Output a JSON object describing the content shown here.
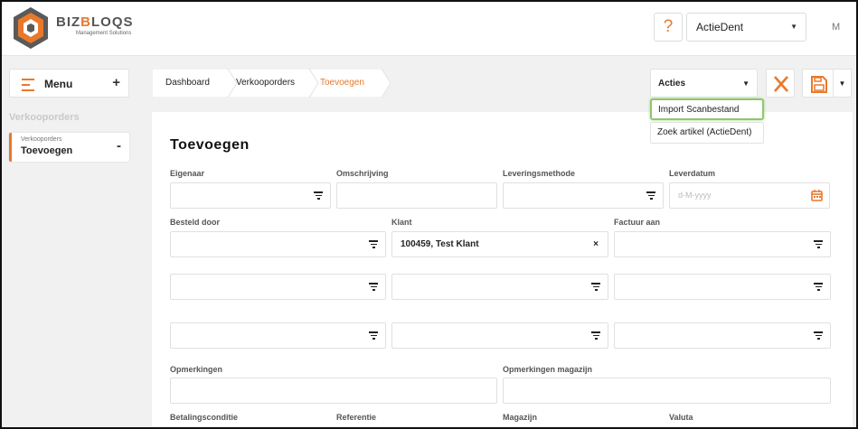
{
  "header": {
    "brand_name_left": "BIZ",
    "brand_name_accent": "B",
    "brand_name_right": "LOQS",
    "brand_sub": "Management Solutions",
    "help_symbol": "?",
    "company": "ActieDent",
    "user_initial": "M"
  },
  "sidebar": {
    "menu_label": "Menu",
    "menu_plus": "+",
    "section_title": "Verkooporders",
    "item_small": "Verkooporders",
    "item_big": "Toevoegen",
    "item_toggle": "-"
  },
  "breadcrumb": [
    "Dashboard",
    "Verkooporders",
    "Toevoegen"
  ],
  "toolbar": {
    "acties_label": "Acties",
    "dropdown_items": [
      "Import  Scanbestand",
      "Zoek  artikel  (ActieDent)"
    ]
  },
  "form": {
    "title": "Toevoegen",
    "labels": {
      "eigenaar": "Eigenaar",
      "omschrijving": "Omschrijving",
      "leveringsmethode": "Leveringsmethode",
      "leverdatum": "Leverdatum",
      "besteld_door": "Besteld  door",
      "klant": "Klant",
      "factuur_aan": "Factuur  aan",
      "opmerkingen": "Opmerkingen",
      "opmerkingen_magazijn": "Opmerkingen  magazijn",
      "betalingsconditie": "Betalingsconditie",
      "referentie": "Referentie",
      "magazijn": "Magazijn",
      "valuta": "Valuta"
    },
    "klant_value": "100459,  Test  Klant",
    "klant_clear": "×",
    "leverdatum_placeholder": "d-M-yyyy"
  },
  "colors": {
    "accent": "#e8792b",
    "highlight": "#8fc66e"
  },
  "icons": {
    "filter": "filter-icon",
    "calendar": "calendar-icon",
    "cancel": "close-icon",
    "save": "save-icon",
    "menu": "hamburger-icon"
  }
}
